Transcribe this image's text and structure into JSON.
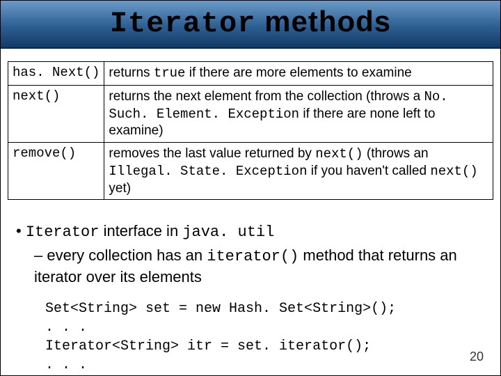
{
  "title": {
    "mono": "Iterator",
    "rest": " methods"
  },
  "rows": [
    {
      "m": "has. Next()",
      "d_pre": "returns ",
      "d_mono": "true",
      "d_post": " if there are more elements to examine"
    },
    {
      "m": "next()",
      "d": "returns the next element from the collection (throws a ",
      "d_mono": "No. Such. Element. Exception",
      "d_post": " if there are none left to examine)"
    },
    {
      "m": "remove()",
      "d_pre": "removes the last value returned by ",
      "d_mono": "next()",
      "d_mid": "   (throws an ",
      "d_mono2": "Illegal. State. Exception",
      "d_mid2": " if you haven't called ",
      "d_mono3": "next()",
      "d_post": " yet)"
    }
  ],
  "bullet": {
    "pre": "",
    "mono": "Iterator",
    "mid": " interface in ",
    "mono2": "java. util",
    "sub_pre": "every collection has an ",
    "sub_mono": "iterator()",
    "sub_post": " method that returns an iterator over its elements"
  },
  "code_lines": [
    "Set<String> set = new Hash. Set<String>();",
    ". . .",
    "Iterator<String> itr = set. iterator();",
    ". . ."
  ],
  "page": "20"
}
